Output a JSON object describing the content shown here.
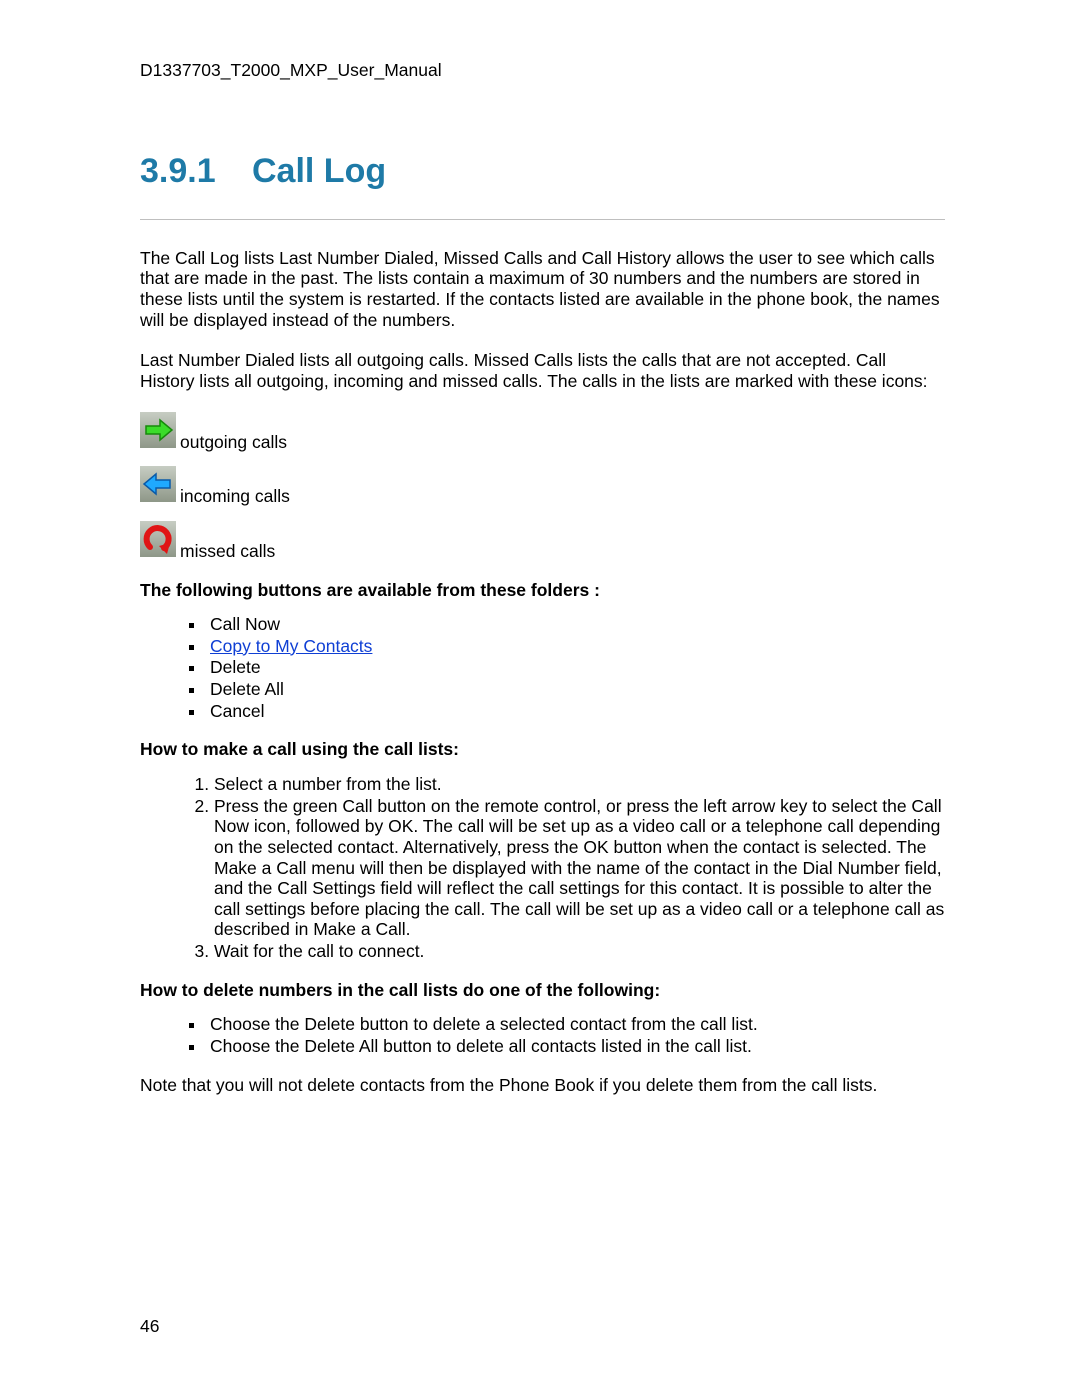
{
  "header": {
    "doc_id": "D1337703_T2000_MXP_User_Manual"
  },
  "section": {
    "number": "3.9.1",
    "title": "Call Log"
  },
  "intro": {
    "p1": "The Call Log lists Last Number Dialed, Missed Calls and Call History allows the user to see which calls that are made in the past. The lists contain a maximum of 30 numbers and the numbers are stored in these lists until the system is restarted. If the contacts listed are available in the phone book, the names will be displayed instead of the numbers.",
    "p2": "Last Number Dialed lists all outgoing calls. Missed Calls lists the calls that are not accepted. Call History lists all outgoing, incoming and missed calls. The calls in the lists are marked with these icons:"
  },
  "icons": {
    "outgoing": "outgoing calls",
    "incoming": "incoming calls",
    "missed": "missed calls"
  },
  "buttons_heading": "The following buttons are available from these folders :",
  "buttons": {
    "b1": "Call Now",
    "b2": "Copy to My Contacts",
    "b3": "Delete",
    "b4": "Delete All",
    "b5": "Cancel"
  },
  "howto_call_heading": "How to make a call using the call lists:",
  "howto_call": {
    "s1": "Select a number from the list.",
    "s2": "Press the green Call button on the remote control, or press the left arrow key to select the Call Now icon, followed by OK. The call will be set up as a video call or a telephone call depending on the selected contact. Alternatively, press the OK button when the contact is selected. The Make a Call menu will then be displayed with the name of the contact in the Dial Number field, and the Call Settings field will reflect the call settings for this contact. It is possible to alter the call settings before placing the call. The call will be set up as a video call or a telephone call as described in Make a Call.",
    "s3": "Wait for the call to connect."
  },
  "howto_delete_heading": "How to delete numbers in the call lists do one of the following:",
  "howto_delete": {
    "d1": "Choose the Delete button to delete a selected contact from the call list.",
    "d2": "Choose the Delete All button to delete all contacts listed in the call list."
  },
  "note": "Note that you will not delete contacts from the Phone Book if you delete them from the call lists.",
  "page_number": "46"
}
